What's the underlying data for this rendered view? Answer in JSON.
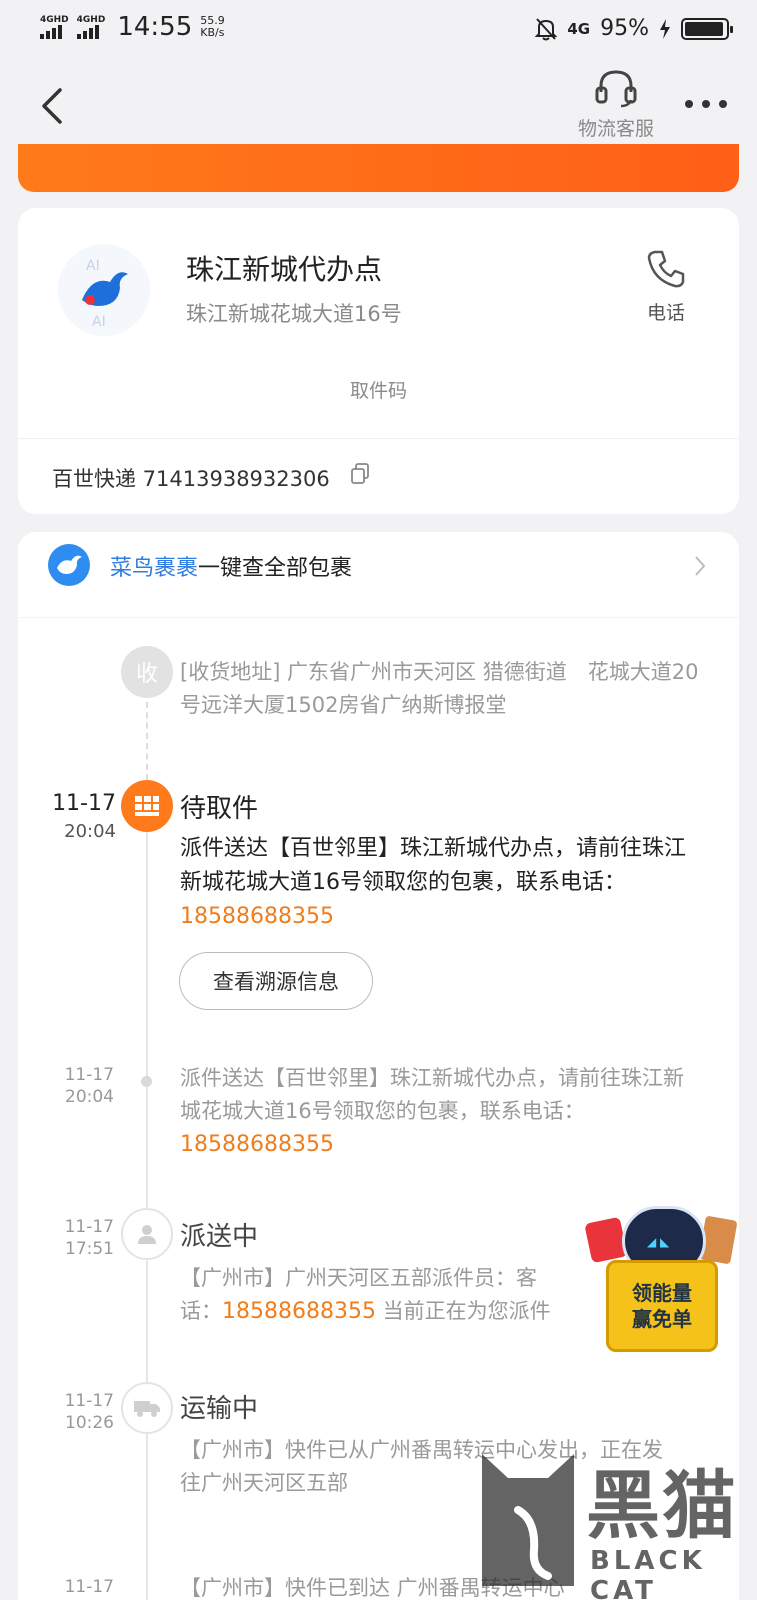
{
  "status_bar": {
    "signal1": "4GHD",
    "signal2": "4GHD",
    "time": "14:55",
    "net_speed_value": "55.9",
    "net_speed_unit": "KB/s",
    "net_type": "4G",
    "battery_percent": "95%",
    "battery_level": 0.95
  },
  "nav": {
    "service_label": "物流客服"
  },
  "station": {
    "name": "珠江新城代办点",
    "address": "珠江新城花城大道16号",
    "phone_label": "电话",
    "pickup_code_label": "取件码",
    "tracking": "百世快递 71413938932306"
  },
  "cainiao": {
    "brand": "菜鸟裹裹",
    "text": "一键查全部包裹"
  },
  "timeline": {
    "receiver_node": "收",
    "receiver_address": "[收货地址] 广东省广州市天河区 猎德街道　花城大道20号远洋大厦1502房省广纳斯博报堂",
    "events": [
      {
        "date": "11-17",
        "time": "20:04",
        "title": "待取件",
        "text": "派件送达【百世邻里】珠江新城代办点，请前往珠江新城花城大道16号领取您的包裹，联系电话：",
        "phone": "18588688355",
        "button": "查看溯源信息"
      },
      {
        "date": "11-17",
        "time": "20:04",
        "text": "派件送达【百世邻里】珠江新城代办点，请前往珠江新城花城大道16号领取您的包裹，联系电话：",
        "phone": "18588688355"
      },
      {
        "date": "11-17",
        "time": "17:51",
        "title": "派送中",
        "text_line1": "【广州市】广州天河区五部派件员：客",
        "text_line2_prefix": "话：",
        "phone": "18588688355",
        "text_line2_suffix": " 当前正在为您派件"
      },
      {
        "date": "11-17",
        "time": "10:26",
        "title": "运输中",
        "text": "【广州市】快件已从广州番禺转运中心发出，正在发往广州天河区五部"
      },
      {
        "date": "11-17",
        "text": "【广州市】快件已到达 广州番禺转运中心"
      }
    ]
  },
  "promo": {
    "line1": "领能量",
    "line2": "赢免单"
  },
  "watermark": {
    "cn": "黑猫",
    "en": "BLACK CAT"
  },
  "colors": {
    "accent_orange": "#ff7a1a",
    "phone_orange": "#f07d1c",
    "cainiao_blue": "#2f7de0"
  }
}
